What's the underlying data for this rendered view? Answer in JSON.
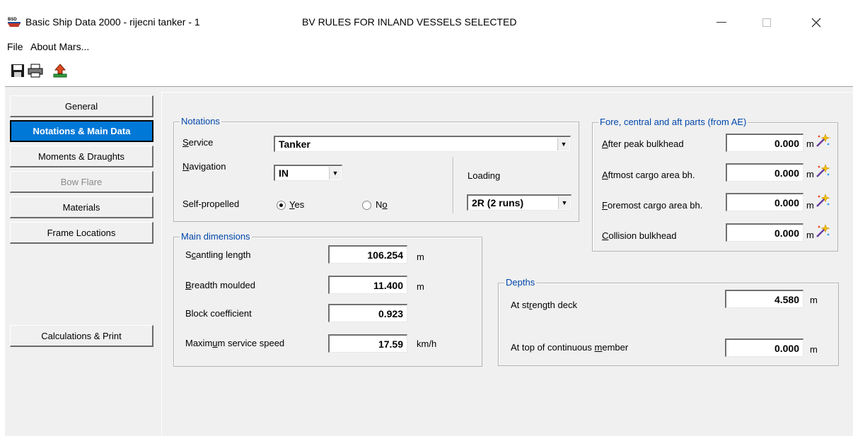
{
  "window": {
    "title": "Basic Ship Data 2000 - rijecni tanker - 1",
    "status": "BV RULES FOR INLAND VESSELS SELECTED",
    "icon_text": "BSD"
  },
  "menu": {
    "file": "File",
    "about": "About Mars..."
  },
  "toolbar": {
    "icons": [
      "save-icon",
      "print-icon",
      "export-icon"
    ]
  },
  "nav": {
    "items": [
      {
        "label": "General",
        "state": "normal"
      },
      {
        "label": "Notations & Main Data",
        "state": "active"
      },
      {
        "label": "Moments & Draughts",
        "state": "normal"
      },
      {
        "label": "Bow Flare",
        "state": "disabled"
      },
      {
        "label": "Materials",
        "state": "normal"
      },
      {
        "label": "Frame Locations",
        "state": "normal"
      }
    ],
    "calc": "Calculations & Print"
  },
  "notations": {
    "title": "Notations",
    "service_label_u": "S",
    "service_label_rest": "ervice",
    "service_value": "Tanker",
    "navigation_label_u": "N",
    "navigation_label_rest": "avigation",
    "navigation_value": "IN",
    "self_propelled_label": "Self-propelled",
    "yes_u": "Y",
    "yes_rest": "es",
    "no_a": "N",
    "no_u": "o",
    "self_propelled_selected": "Yes",
    "loading_label": "Loading",
    "loading_value": "2R (2 runs)"
  },
  "main_dimensions": {
    "title": "Main dimensions",
    "scantling_a": "S",
    "scantling_u": "c",
    "scantling_rest": "antling length",
    "scantling_value": "106.254",
    "scantling_unit": "m",
    "breadth_u": "B",
    "breadth_rest": "readth moulded",
    "breadth_value": "11.400",
    "breadth_unit": "m",
    "block_label": "Block coefficient",
    "block_value": "0.923",
    "speed_a": "Maxim",
    "speed_u": "u",
    "speed_rest": "m service speed",
    "speed_value": "17.59",
    "speed_unit": "km/h"
  },
  "fore_aft": {
    "title": "Fore, central and aft parts (from AE)",
    "rows": [
      {
        "u": "A",
        "rest": "fter peak bulkhead",
        "value": "0.000",
        "unit": "m"
      },
      {
        "u": "A",
        "rest": "ftmost cargo area bh.",
        "value": "0.000",
        "unit": "m"
      },
      {
        "u": "F",
        "rest": "oremost cargo area bh.",
        "value": "0.000",
        "unit": "m"
      },
      {
        "u": "C",
        "rest": "ollision bulkhead",
        "value": "0.000",
        "unit": "m"
      }
    ]
  },
  "depths": {
    "title": "Depths",
    "strength_a": "At st",
    "strength_u": "r",
    "strength_rest": "ength deck",
    "strength_value": "4.580",
    "strength_unit": "m",
    "top_a": "At top of continuous ",
    "top_u": "m",
    "top_rest": "ember",
    "top_value": "0.000",
    "top_unit": "m"
  }
}
